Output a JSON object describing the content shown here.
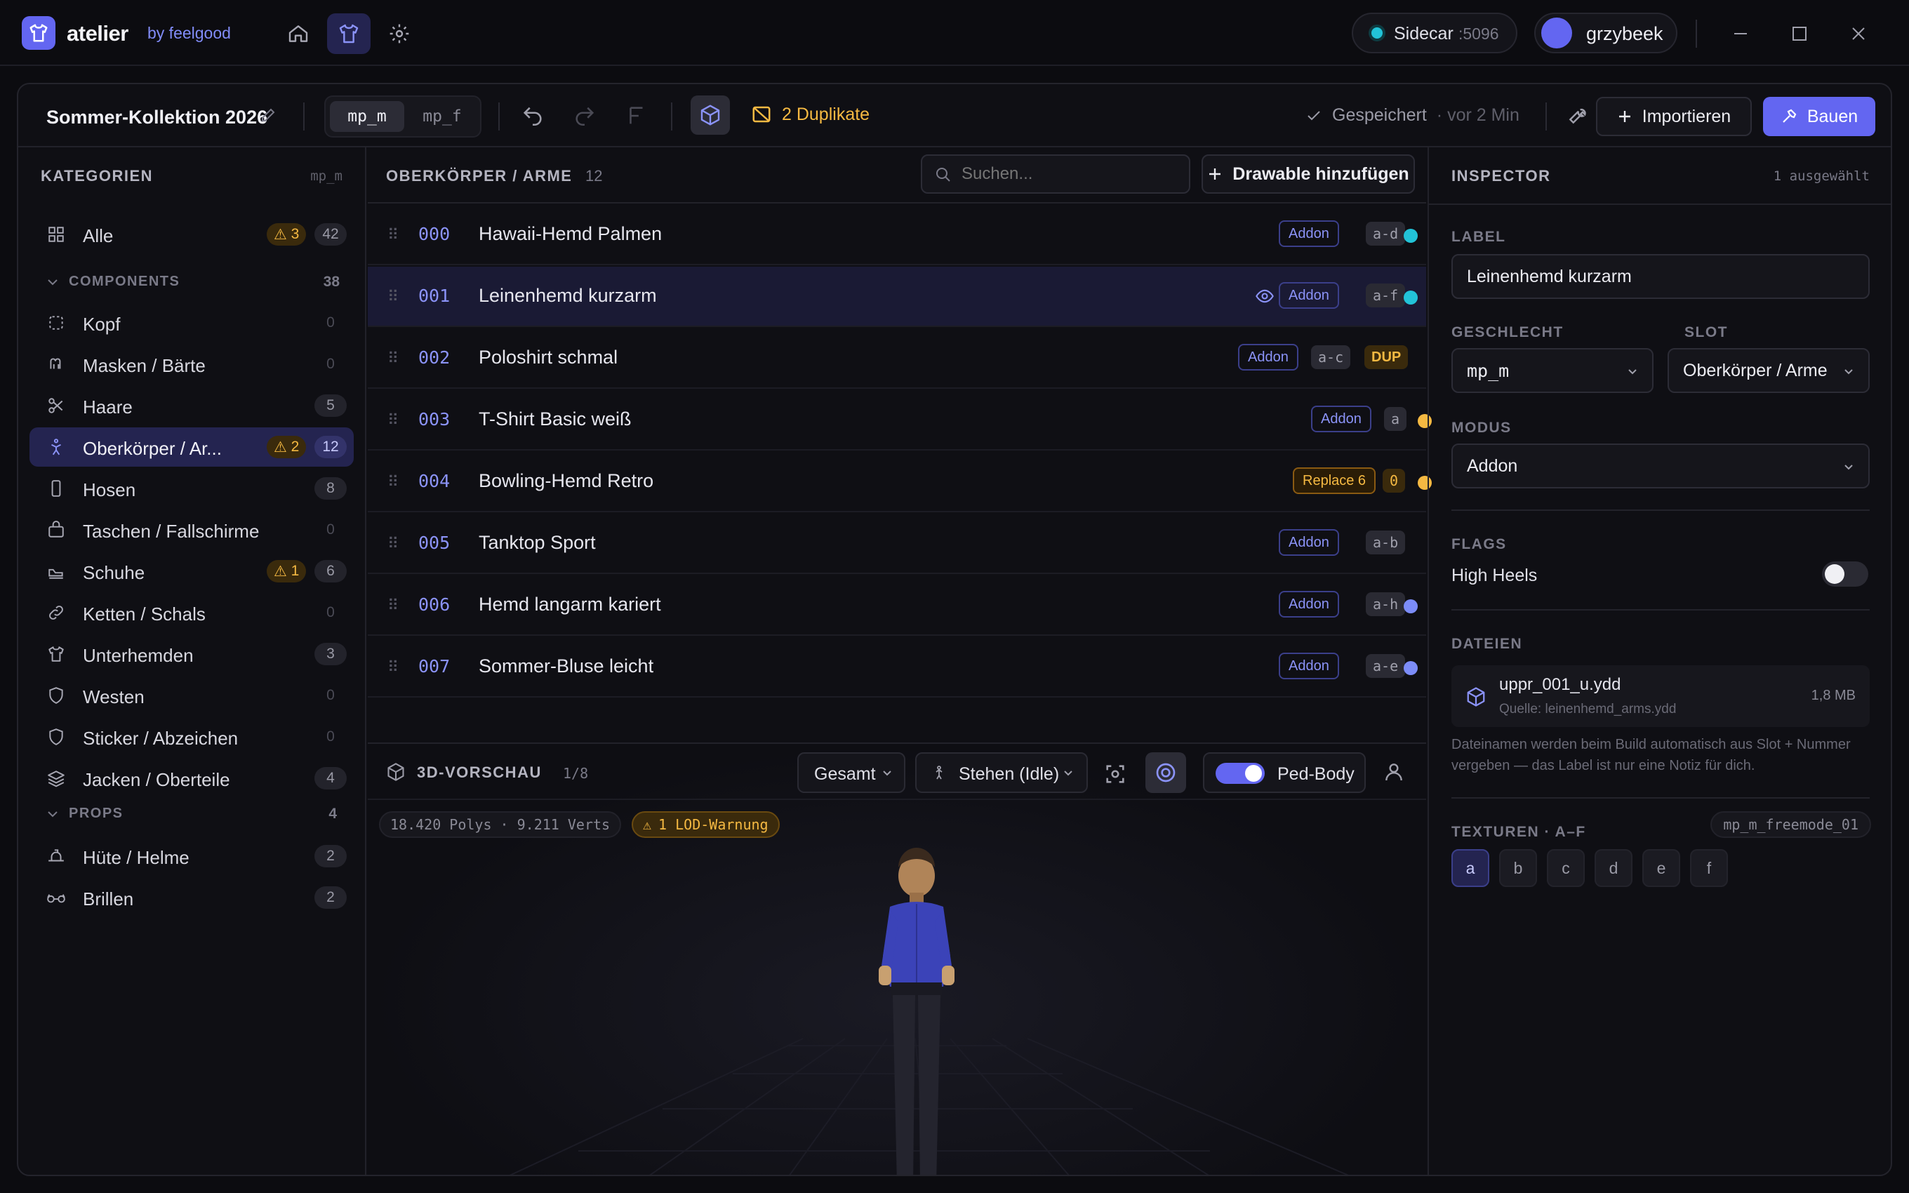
{
  "app": {
    "name": "atelier",
    "by": "by feelgood"
  },
  "sidecar": {
    "label": "Sidecar",
    "port": ":5096"
  },
  "user": {
    "name": "grzybeek"
  },
  "project": {
    "title": "Sommer-Kollektion 2026",
    "genders": [
      "mp_m",
      "mp_f"
    ],
    "active_gender": "mp_m",
    "duplicates": "2 Duplikate",
    "saved": "Gespeichert",
    "saved_time": "· vor 2 Min",
    "import_label": "Importieren",
    "build_label": "Bauen"
  },
  "sidebar": {
    "title": "KATEGORIEN",
    "gender": "mp_m",
    "all": {
      "label": "Alle",
      "warn": "3",
      "count": "42"
    },
    "components_header": "COMPONENTS",
    "components_count": "38",
    "components": [
      {
        "label": "Kopf",
        "count": "0"
      },
      {
        "label": "Masken / Bärte",
        "count": "0"
      },
      {
        "label": "Haare",
        "count": "5"
      },
      {
        "label": "Oberkörper / Ar...",
        "count": "12",
        "warn": "2",
        "active": true
      },
      {
        "label": "Hosen",
        "count": "8"
      },
      {
        "label": "Taschen / Fallschirme",
        "count": "0"
      },
      {
        "label": "Schuhe",
        "count": "6",
        "warn": "1"
      },
      {
        "label": "Ketten / Schals",
        "count": "0"
      },
      {
        "label": "Unterhemden",
        "count": "3"
      },
      {
        "label": "Westen",
        "count": "0"
      },
      {
        "label": "Sticker / Abzeichen",
        "count": "0"
      },
      {
        "label": "Jacken / Oberteile",
        "count": "4"
      }
    ],
    "props_header": "PROPS",
    "props_count": "4",
    "props": [
      {
        "label": "Hüte / Helme",
        "count": "2"
      },
      {
        "label": "Brillen",
        "count": "2"
      }
    ]
  },
  "list": {
    "title": "OBERKÖRPER / ARME",
    "count": "12",
    "search_placeholder": "Suchen...",
    "add_label": "Drawable hinzufügen",
    "rows": [
      {
        "num": "000",
        "name": "Hawaii-Hemd Palmen",
        "mode": "Addon",
        "tex": "a-d",
        "dot": "#22c3d8"
      },
      {
        "num": "001",
        "name": "Leinenhemd kurzarm",
        "mode": "Addon",
        "tex": "a-f",
        "dot": "#22c3d8",
        "selected": true
      },
      {
        "num": "002",
        "name": "Poloshirt schmal",
        "mode": "Addon",
        "tex": "a-c",
        "dup": "DUP"
      },
      {
        "num": "003",
        "name": "T-Shirt Basic weiß",
        "mode": "Addon",
        "tex": "a",
        "dot": "#f5b942"
      },
      {
        "num": "004",
        "name": "Bowling-Hemd Retro",
        "mode": "Replace 6",
        "tex": "0",
        "dot": "#f5b942",
        "replace": true
      },
      {
        "num": "005",
        "name": "Tanktop Sport",
        "mode": "Addon",
        "tex": "a-b"
      },
      {
        "num": "006",
        "name": "Hemd langarm kariert",
        "mode": "Addon",
        "tex": "a-h",
        "dot": "#7c8cf8"
      },
      {
        "num": "007",
        "name": "Sommer-Bluse leicht",
        "mode": "Addon",
        "tex": "a-e",
        "dot": "#7c8cf8"
      }
    ]
  },
  "preview": {
    "title": "3D-VORSCHAU",
    "index": "1/8",
    "view": "Gesamt",
    "anim": "Stehen (Idle)",
    "ped_body": "Ped-Body",
    "ped_body_on": true,
    "stats": "18.420 Polys · 9.211 Verts",
    "lod_warning": "1 LOD-Warnung",
    "model": "mp_m_freemode_01"
  },
  "inspector": {
    "title": "INSPECTOR",
    "selected": "1 ausgewählt",
    "label_title": "LABEL",
    "label_value": "Leinenhemd kurzarm",
    "gender_title": "GESCHLECHT",
    "gender_value": "mp_m",
    "slot_title": "SLOT",
    "slot_value": "Oberkörper / Arme",
    "mode_title": "MODUS",
    "mode_value": "Addon",
    "flags_title": "FLAGS",
    "flag_high_heels": "High Heels",
    "flag_high_heels_on": false,
    "files_title": "DATEIEN",
    "file_name": "uppr_001_u.ydd",
    "file_source": "Quelle: leinenhemd_arms.ydd",
    "file_size": "1,8 MB",
    "files_note": "Dateinamen werden beim Build automatisch aus Slot + Nummer vergeben — das Label ist nur eine Notiz für dich.",
    "textures_title": "TEXTUREN · A–F",
    "textures": [
      "a",
      "b",
      "c",
      "d",
      "e",
      "f"
    ],
    "active_texture": "a"
  }
}
